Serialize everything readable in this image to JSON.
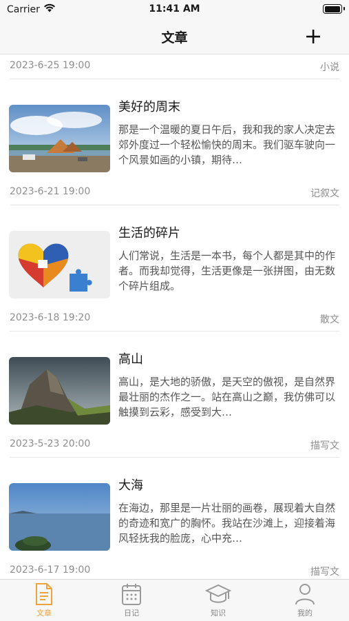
{
  "status": {
    "carrier": "Carrier",
    "time": "11:41 AM"
  },
  "nav": {
    "title": "文章"
  },
  "top_meta": {
    "date": "2023-6-25 19:00",
    "category": "小说"
  },
  "articles": [
    {
      "title": "美好的周末",
      "summary": "那是一个温暖的夏日午后，我和我的家人决定去郊外度过一个轻松愉快的周末。我们驱车驶向一个风景如画的小镇，期待…",
      "date": "2023-6-21 19:00",
      "category": "记叙文",
      "image": "camping-landscape"
    },
    {
      "title": "生活的碎片",
      "summary": "人们常说，生活是一本书，每个人都是其中的作者。而我却觉得，生活更像是一张拼图，由无数个碎片组成。",
      "date": "2023-6-18 19:20",
      "category": "散文",
      "image": "puzzle-heart"
    },
    {
      "title": "高山",
      "summary": "高山，是大地的骄傲，是天空的傲视，是自然界最壮丽的杰作之一。站在高山之巅，我仿佛可以触摸到云彩，感受到大…",
      "date": "2023-5-23 20:00",
      "category": "描写文",
      "image": "mountain-peak"
    },
    {
      "title": "大海",
      "summary": "在海边，那里是一片壮丽的画卷，展现着大自然的奇迹和宽广的胸怀。我站在沙滩上，迎接着海风轻抚我的脸庞，心中充…",
      "date": "2023-6-17 19:00",
      "category": "描写文",
      "image": "sea-view"
    }
  ],
  "tabs": [
    {
      "label": "文章",
      "icon": "document-icon",
      "active": true
    },
    {
      "label": "日记",
      "icon": "calendar-icon",
      "active": false
    },
    {
      "label": "知识",
      "icon": "graduation-cap-icon",
      "active": false
    },
    {
      "label": "我的",
      "icon": "person-icon",
      "active": false
    }
  ],
  "colors": {
    "accent": "#f0a23b",
    "text": "#1a1a1a",
    "meta": "#8e8e8e"
  }
}
